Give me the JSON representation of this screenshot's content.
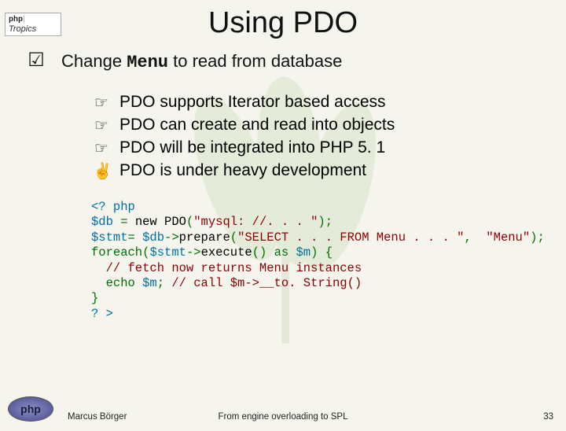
{
  "brand": {
    "top_php": "php",
    "top_pipe": "|",
    "top_tropics": "Tropics",
    "bottom_php": "php"
  },
  "title": "Using PDO",
  "main": {
    "check": "☑",
    "text_before": "Change ",
    "menu_word": "Menu",
    "text_after": " to read from database"
  },
  "bullets": [
    {
      "icon": "☞",
      "text": "PDO supports Iterator based access"
    },
    {
      "icon": "☞",
      "text": "PDO can create and read into objects"
    },
    {
      "icon": "☞",
      "text": "PDO will be integrated into PHP 5. 1"
    },
    {
      "icon": "✌",
      "text": "PDO is under heavy development"
    }
  ],
  "code": {
    "l1a": "<? php",
    "l2a": "$db",
    "l2b": " = ",
    "l2c": "new ",
    "l2d": "PDO",
    "l2e": "(",
    "l2f": "\"mysql: //. . . \"",
    "l2g": ");",
    "l3a": "$stmt",
    "l3b": "= ",
    "l3c": "$db",
    "l3d": "->",
    "l3e": "prepare",
    "l3f": "(",
    "l3g": "\"SELECT . . . FROM Menu . . . \"",
    "l3h": ",  ",
    "l3i": "\"Menu\"",
    "l3j": ");",
    "l4a": "foreach",
    "l4b": "(",
    "l4c": "$stmt",
    "l4d": "->",
    "l4e": "execute",
    "l4f": "() as ",
    "l4g": "$m",
    "l4h": ") {",
    "l5a": "  // fetch now returns Menu instances",
    "l6a": "  echo ",
    "l6b": "$m",
    "l6c": "; ",
    "l6d": "// call $m->__to. String()",
    "l7a": "}",
    "l8a": "? >"
  },
  "footer": {
    "author": "Marcus Börger",
    "mid": "From engine overloading to SPL",
    "page": "33"
  }
}
